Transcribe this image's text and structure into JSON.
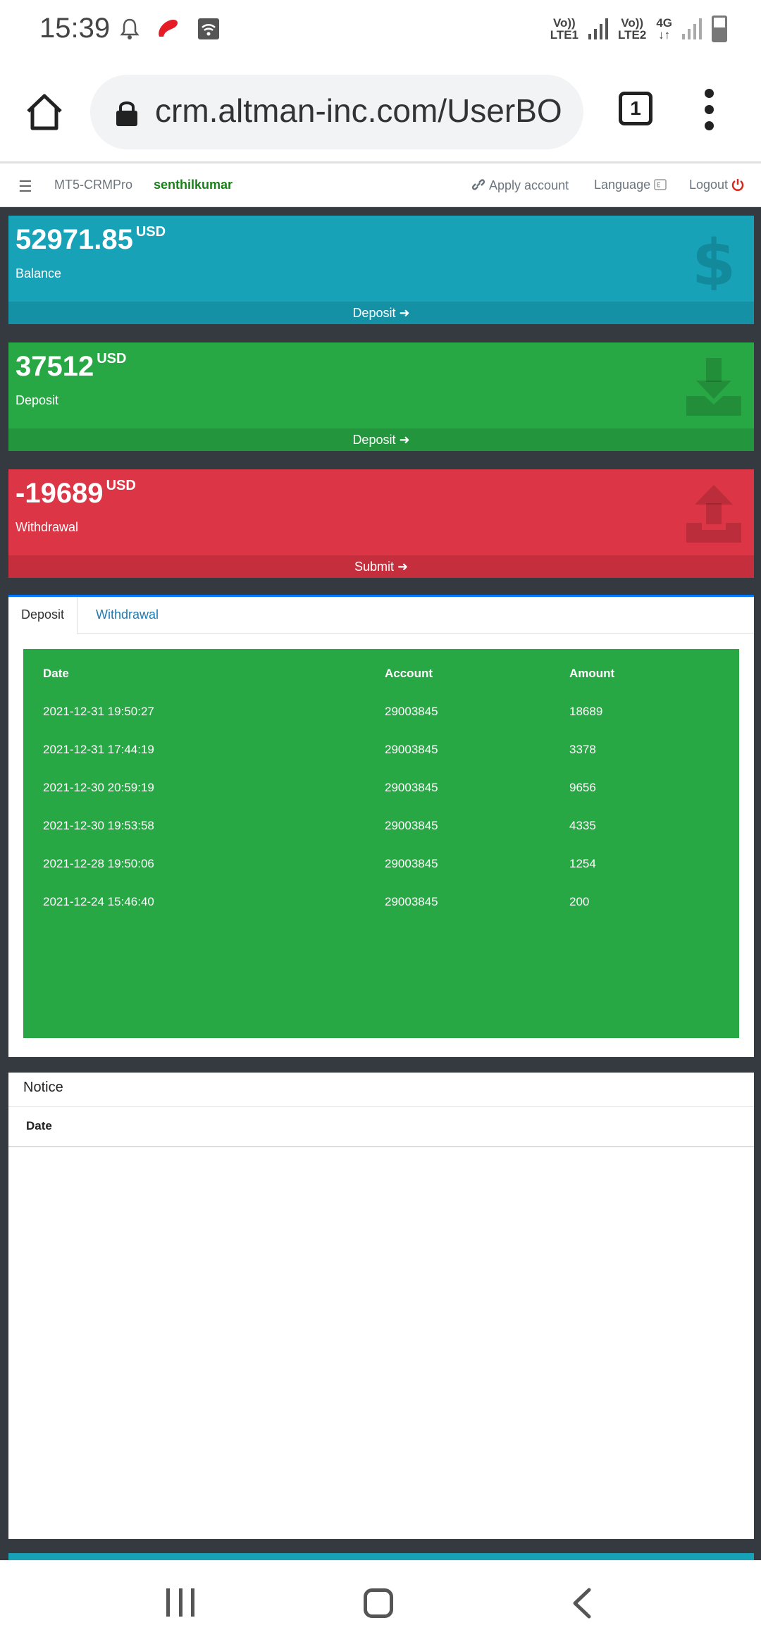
{
  "status_bar": {
    "time": "15:39",
    "sim1": {
      "top": "Vo))",
      "bottom": "LTE1"
    },
    "sim2": {
      "top": "Vo))",
      "bottom": "LTE2"
    },
    "network": {
      "top": "4G",
      "bottom": "↓↑"
    }
  },
  "browser": {
    "url": "crm.altman-inc.com/UserBO",
    "tab_count": "1"
  },
  "nav": {
    "menu_icon": "☰",
    "brand": "MT5-CRMPro",
    "user": "senthilkumar",
    "apply_account": "Apply account",
    "language": "Language",
    "logout": "Logout"
  },
  "cards": {
    "balance": {
      "amount": "52971.85",
      "currency": "USD",
      "label": "Balance",
      "action": "Deposit ➜"
    },
    "deposit": {
      "amount": "37512",
      "currency": "USD",
      "label": "Deposit",
      "action": "Deposit ➜"
    },
    "withdrawal": {
      "amount": "-19689",
      "currency": "USD",
      "label": "Withdrawal",
      "action": "Submit ➜"
    }
  },
  "tabs": {
    "deposit": "Deposit",
    "withdrawal": "Withdrawal"
  },
  "deposit_table": {
    "headers": [
      "Date",
      "Account",
      "Amount"
    ],
    "rows": [
      [
        "2021-12-31 19:50:27",
        "29003845",
        "18689"
      ],
      [
        "2021-12-31 17:44:19",
        "29003845",
        "3378"
      ],
      [
        "2021-12-30 20:59:19",
        "29003845",
        "9656"
      ],
      [
        "2021-12-30 19:53:58",
        "29003845",
        "4335"
      ],
      [
        "2021-12-28 19:50:06",
        "29003845",
        "1254"
      ],
      [
        "2021-12-24 15:46:40",
        "29003845",
        "200"
      ]
    ]
  },
  "notice": {
    "title": "Notice",
    "date_header": "Date"
  },
  "colors": {
    "balance": "#17a2b8",
    "deposit": "#28a745",
    "withdrawal": "#dc3545",
    "page_bg": "#343a40"
  }
}
